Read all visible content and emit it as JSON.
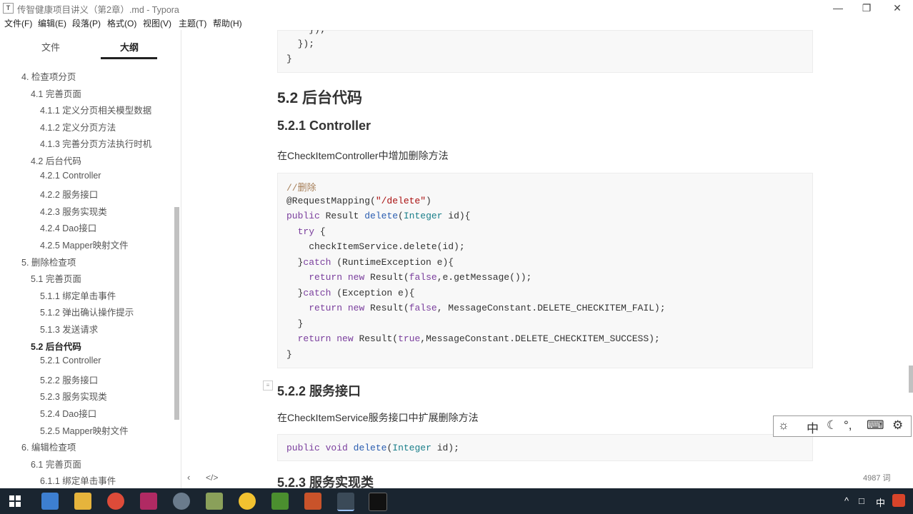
{
  "window": {
    "title": "传智健康项目讲义（第2章）.md - Typora",
    "app_icon": "T",
    "minimize_icon": "minimize-icon",
    "maximize_icon": "restore-icon",
    "close_icon": "close-icon"
  },
  "menu": [
    "文件(F)",
    "编辑(E)",
    "段落(P)",
    "格式(O)",
    "视图(V)",
    "主题(T)",
    "帮助(H)"
  ],
  "sidebar": {
    "tabs": [
      "文件",
      "大纲"
    ],
    "active_tab": "大纲",
    "outline": [
      {
        "label": "4. 检查项分页",
        "level": 1
      },
      {
        "label": "4.1 完善页面",
        "level": 2
      },
      {
        "label": "4.1.1 定义分页相关模型数据",
        "level": 3
      },
      {
        "label": "4.1.2 定义分页方法",
        "level": 3
      },
      {
        "label": "4.1.3 完善分页方法执行时机",
        "level": 3
      },
      {
        "label": "4.2 后台代码",
        "level": 2
      },
      {
        "label": "4.2.1 Controller",
        "level": 3
      },
      {
        "label": "4.2.2 服务接口",
        "level": 3
      },
      {
        "label": "4.2.3 服务实现类",
        "level": 3
      },
      {
        "label": "4.2.4 Dao接口",
        "level": 3
      },
      {
        "label": "4.2.5 Mapper映射文件",
        "level": 3
      },
      {
        "label": "5. 删除检查项",
        "level": 1
      },
      {
        "label": "5.1 完善页面",
        "level": 2
      },
      {
        "label": "5.1.1 绑定单击事件",
        "level": 3
      },
      {
        "label": "5.1.2 弹出确认操作提示",
        "level": 3
      },
      {
        "label": "5.1.3 发送请求",
        "level": 3
      },
      {
        "label": "5.2 后台代码",
        "level": 2,
        "active": true
      },
      {
        "label": "5.2.1 Controller",
        "level": 3
      },
      {
        "label": "5.2.2 服务接口",
        "level": 3
      },
      {
        "label": "5.2.3 服务实现类",
        "level": 3
      },
      {
        "label": "5.2.4 Dao接口",
        "level": 3
      },
      {
        "label": "5.2.5 Mapper映射文件",
        "level": 3
      },
      {
        "label": "6. 编辑检查项",
        "level": 1
      },
      {
        "label": "6.1 完善页面",
        "level": 2
      },
      {
        "label": "6.1.1 绑定单击事件",
        "level": 3
      }
    ],
    "footer_left": "‹",
    "footer_code": "</>"
  },
  "editor": {
    "top_code": [
      "    });",
      "  });",
      "}"
    ],
    "h2": "5.2 后台代码",
    "h3_controller": "5.2.1 Controller",
    "para_controller": "在CheckItemController中增加删除方法",
    "code_controller": [
      "//删除",
      "@RequestMapping(\"/delete\")",
      "public Result delete(Integer id){",
      "  try {",
      "    checkItemService.delete(id);",
      "  }catch (RuntimeException e){",
      "    return new Result(false,e.getMessage());",
      "  }catch (Exception e){",
      "    return new Result(false, MessageConstant.DELETE_CHECKITEM_FAIL);",
      "  }",
      "  return new Result(true,MessageConstant.DELETE_CHECKITEM_SUCCESS);",
      "}"
    ],
    "h3_service": "5.2.2 服务接口",
    "para_service": "在CheckItemService服务接口中扩展删除方法",
    "code_service": "public void delete(Integer id);",
    "h3_impl": "5.2.3 服务实现类",
    "word_count": "4987 词"
  },
  "ime_bar": {
    "items": [
      "ime-logo-icon",
      "中",
      "☾",
      "°,",
      "⌨",
      "⚙"
    ]
  },
  "taskbar": {
    "tray": [
      "^",
      "中"
    ],
    "colors": {
      "bg": "#1a2530"
    }
  }
}
